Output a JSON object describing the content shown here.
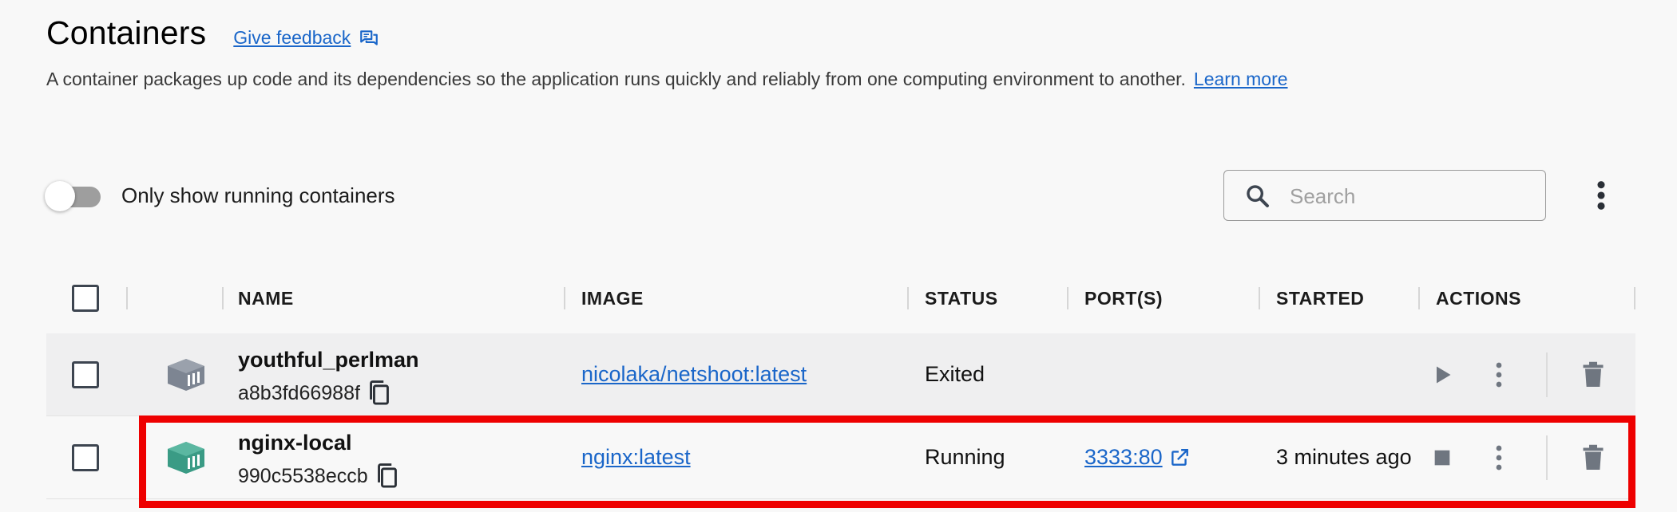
{
  "header": {
    "title": "Containers",
    "feedback_label": "Give feedback",
    "description": "A container packages up code and its dependencies so the application runs quickly and reliably from one computing environment to another.",
    "learn_more": "Learn more"
  },
  "toolbar": {
    "toggle_label": "Only show running containers",
    "toggle_on": false,
    "search_placeholder": "Search"
  },
  "table": {
    "columns": [
      "NAME",
      "IMAGE",
      "STATUS",
      "PORT(S)",
      "STARTED",
      "ACTIONS"
    ],
    "rows": [
      {
        "name": "youthful_perlman",
        "id": "a8b3fd66988f",
        "image": "nicolaka/netshoot:latest",
        "status": "Exited",
        "ports": "",
        "started": "",
        "icon_color": "#7d8592",
        "primary_action": "play-icon"
      },
      {
        "name": "nginx-local",
        "id": "990c5538eccb",
        "image": "nginx:latest",
        "status": "Running",
        "ports": "3333:80",
        "started": "3 minutes ago",
        "icon_color": "#3a9b85",
        "primary_action": "stop-icon"
      }
    ]
  },
  "colors": {
    "link": "#1a66c9",
    "highlight": "#ee0000",
    "running_icon": "#3a9b85",
    "exited_icon": "#7d8592"
  }
}
